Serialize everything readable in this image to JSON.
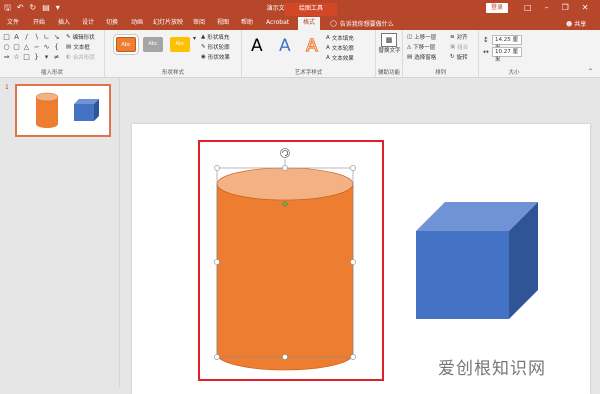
{
  "title_bar": {
    "document_title": "演示文稿1 - PowerPoint",
    "context_tab_title": "绘图工具",
    "login_label": "登录",
    "share_label": "共享"
  },
  "tabs": [
    {
      "label": "文件"
    },
    {
      "label": "开始"
    },
    {
      "label": "插入"
    },
    {
      "label": "设计"
    },
    {
      "label": "切换"
    },
    {
      "label": "动画"
    },
    {
      "label": "幻灯片放映"
    },
    {
      "label": "审阅"
    },
    {
      "label": "视图"
    },
    {
      "label": "帮助"
    },
    {
      "label": "Acrobat"
    },
    {
      "label": "格式",
      "active": true
    }
  ],
  "tell_me": {
    "placeholder": "告诉我你想要做什么"
  },
  "ribbon": {
    "insert_shapes": {
      "label": "插入形状",
      "edit_shape": "编辑形状",
      "text_box": "文本框",
      "merge_shapes": "合并形状"
    },
    "shape_styles": {
      "label": "形状样式",
      "swatch_text": "Abc",
      "fill": "形状填充",
      "outline": "形状轮廓",
      "effects": "形状效果"
    },
    "wordart_styles": {
      "label": "艺术字样式",
      "sample": "A",
      "text_fill": "文本填充",
      "text_outline": "文本轮廓",
      "text_effects": "文本效果"
    },
    "accessibility": {
      "label": "辅助功能",
      "alt_text": "替换文字"
    },
    "arrange": {
      "label": "排列",
      "bring_forward": "上移一层",
      "send_backward": "下移一层",
      "selection_pane": "选择窗格",
      "align": "对齐",
      "group": "组合",
      "rotate": "旋转"
    },
    "size": {
      "label": "大小",
      "height": "14.25 厘米",
      "width": "10.27 厘米"
    }
  },
  "slides_panel": {
    "slide_number": "1"
  },
  "watermark": {
    "text": "爱创根知识网"
  },
  "colors": {
    "accent": "#b7472a",
    "cylinder": "#ed7d31",
    "cylinder_top": "#f4b183",
    "cube": "#4472c4",
    "selection_box": "#e0202a"
  }
}
